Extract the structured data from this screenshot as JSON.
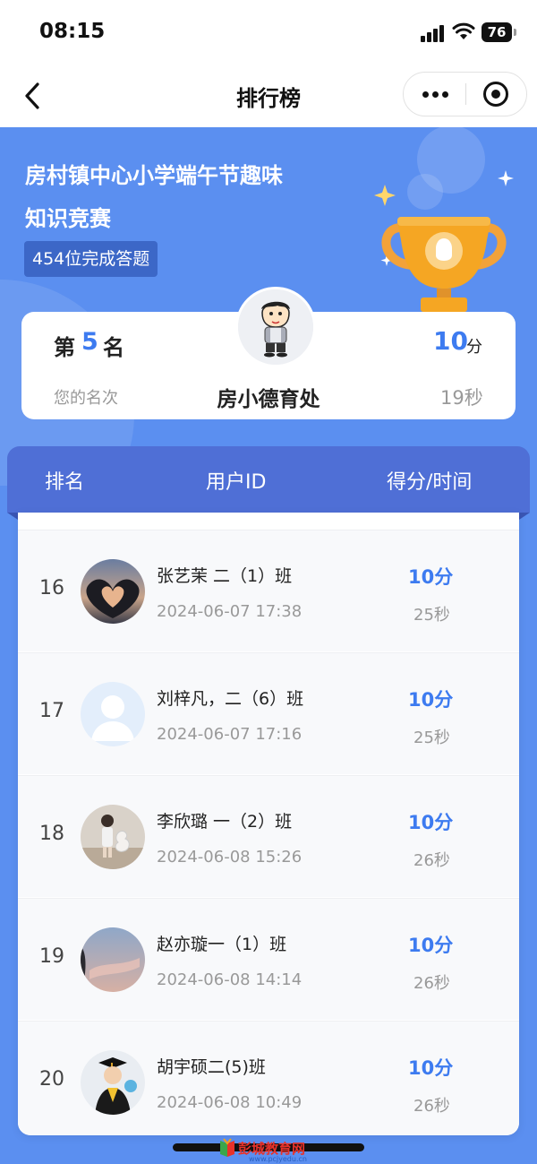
{
  "status_bar": {
    "time": "08:15",
    "battery": "76"
  },
  "nav": {
    "title": "排行榜"
  },
  "hero": {
    "title_line1": "房村镇中心小学端午节趣味",
    "title_line2": "知识竞赛",
    "completed_badge": "454位完成答题"
  },
  "my_rank": {
    "rank_prefix": "第",
    "rank": "5",
    "rank_suffix": "名",
    "rank_caption": "您的名次",
    "name": "房小德育处",
    "score": "10",
    "score_unit": "分",
    "time": "19秒"
  },
  "table_header": {
    "rank": "排名",
    "user_id": "用户ID",
    "score_time": "得分/时间"
  },
  "rows": [
    {
      "index": "16",
      "name": "张艺茉 二（1）班",
      "date": "2024-06-07 17:38",
      "score": "10分",
      "time": "25秒",
      "avatar": "heart-hands-sunset-avatar"
    },
    {
      "index": "17",
      "name": "刘梓凡，二（6）班",
      "date": "2024-06-07 17:16",
      "score": "10分",
      "time": "25秒",
      "avatar": "default-user-avatar"
    },
    {
      "index": "18",
      "name": "李欣璐 一（2）班",
      "date": "2024-06-08 15:26",
      "score": "10分",
      "time": "26秒",
      "avatar": "girl-balloon-avatar"
    },
    {
      "index": "19",
      "name": "赵亦璇一（1）班",
      "date": "2024-06-08 14:14",
      "score": "10分",
      "time": "26秒",
      "avatar": "sky-clouds-avatar"
    },
    {
      "index": "20",
      "name": "胡宇硕二(5)班",
      "date": "2024-06-08 10:49",
      "score": "10分",
      "time": "26秒",
      "avatar": "graduation-child-avatar"
    }
  ],
  "watermark": {
    "text": "彭城教育网",
    "url": "www.pcjyedu.cn"
  },
  "colors": {
    "primary_blue": "#5b8ff0",
    "header_blue": "#4f6fd6",
    "accent_text": "#3d7bf0",
    "trophy_gold": "#f5a623"
  }
}
